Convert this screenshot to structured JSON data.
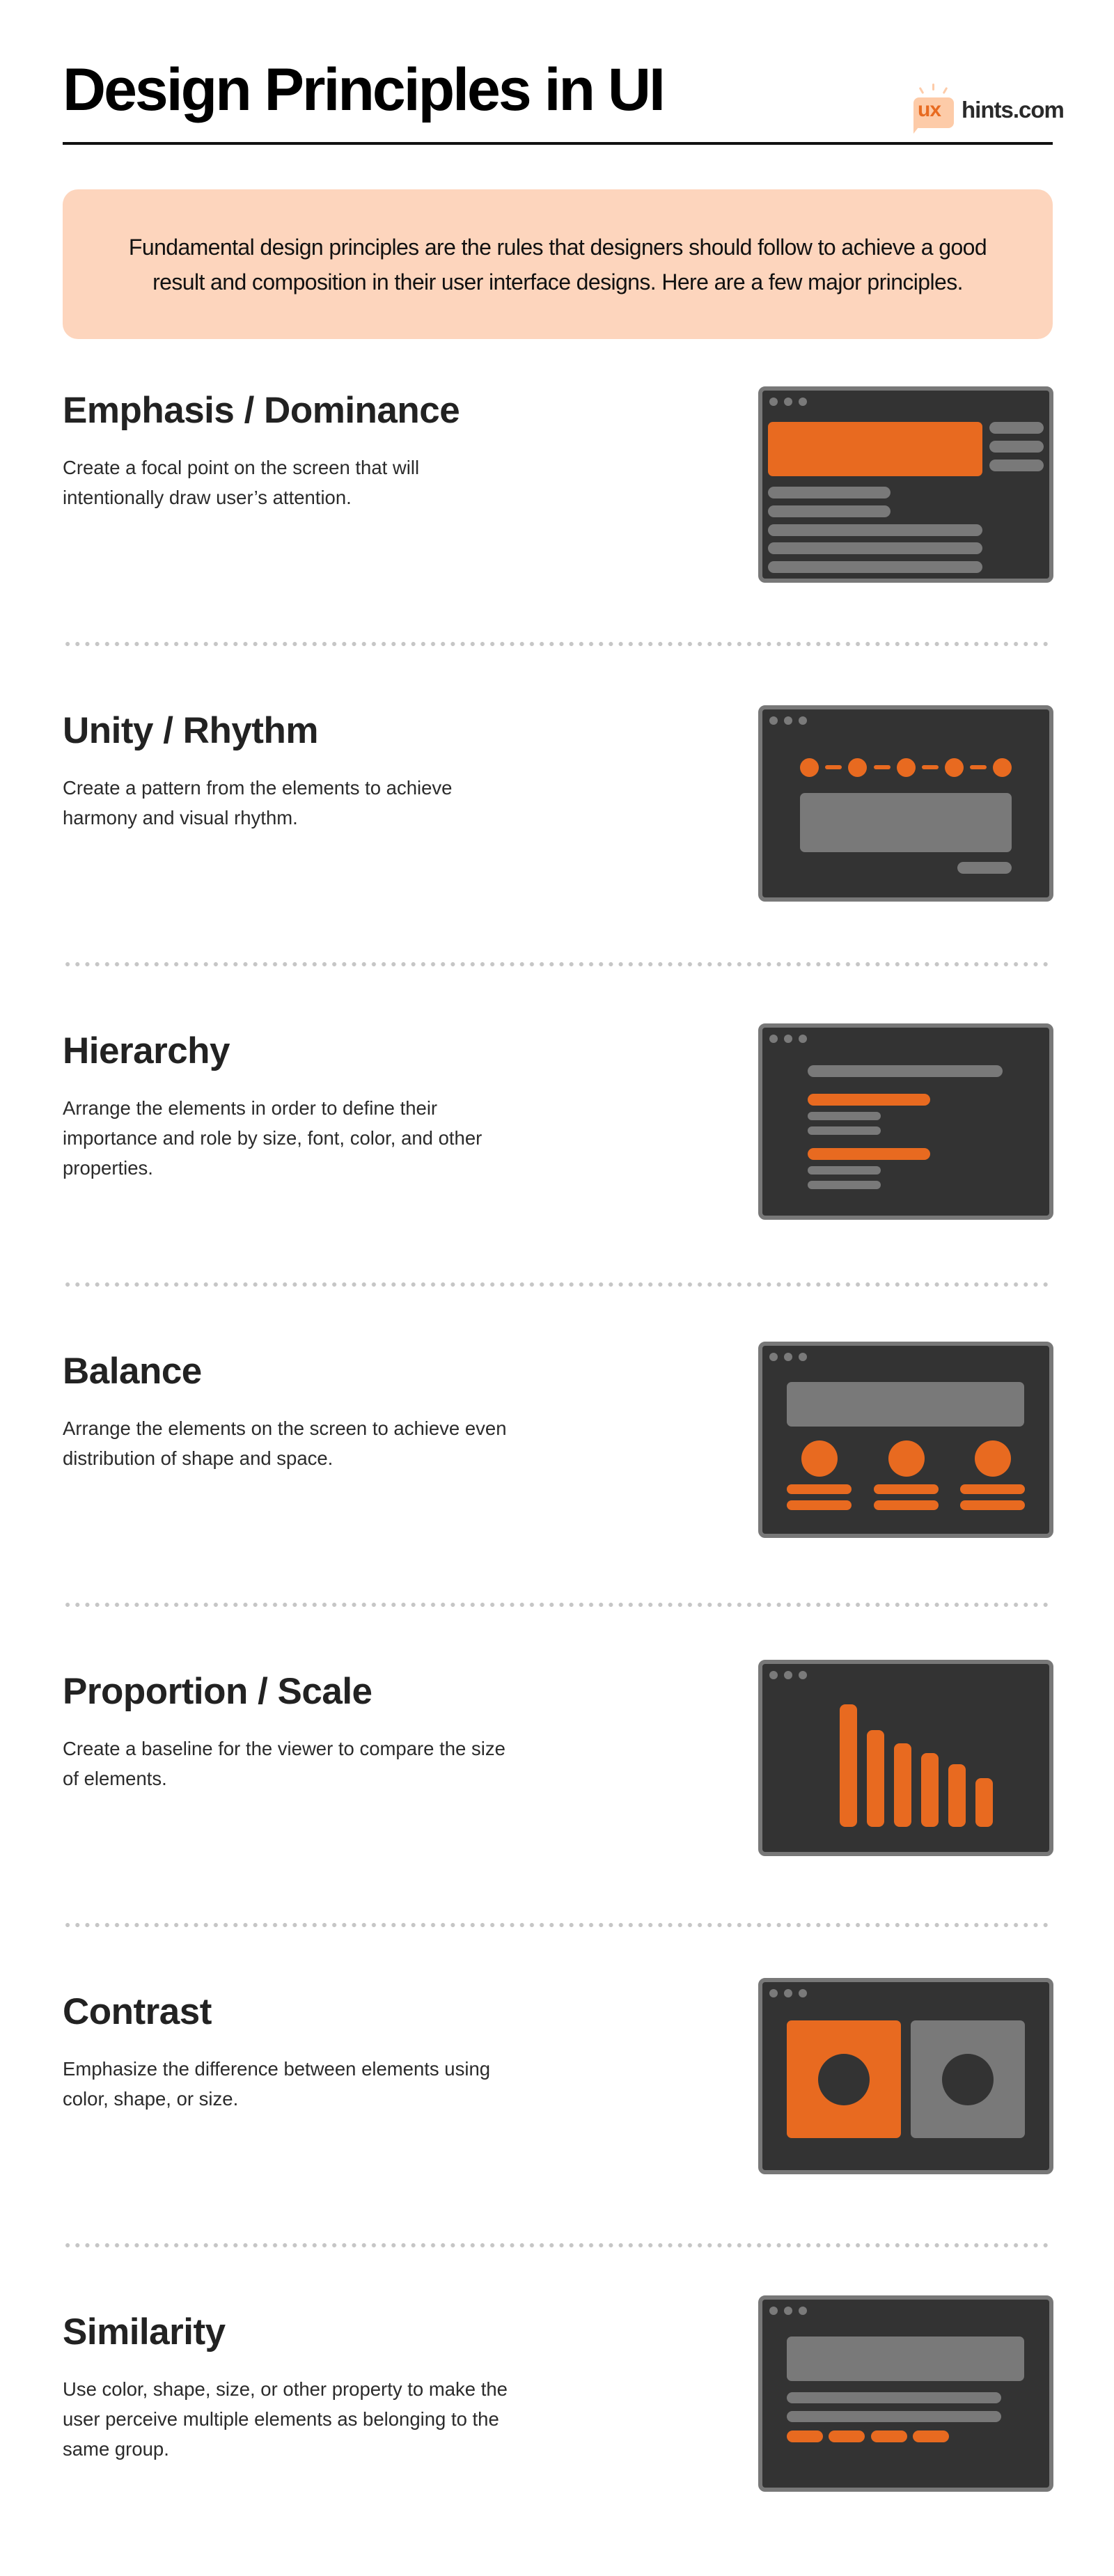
{
  "header": {
    "title": "Design Principles in UI",
    "logo": {
      "badge_text": "ux",
      "site_text": "hints.com",
      "icon": "speech-bubble-icon"
    }
  },
  "intro": {
    "text": "Fundamental design principles are the rules that designers should follow to achieve a good result and composition in their user interface designs. Here are a few major principles."
  },
  "colors": {
    "accent": "#E86A20",
    "intro_bg": "#FDD5BD",
    "window_bg": "#333333",
    "window_border": "#787878",
    "placeholder_gray": "#797979",
    "divider": "#C6C6C6",
    "text": "#222222"
  },
  "sections": [
    {
      "title": "Emphasis / Dominance",
      "description": "Create a focal point on the screen that will intentionally draw user’s attention.",
      "illustration": "emphasis-window-illustration"
    },
    {
      "title": "Unity / Rhythm",
      "description": "Create a pattern from the elements to achieve harmony and visual rhythm.",
      "illustration": "unity-window-illustration"
    },
    {
      "title": "Hierarchy",
      "description": "Arrange the elements in order to define their importance and role by size, font, color, and other properties.",
      "illustration": "hierarchy-window-illustration"
    },
    {
      "title": "Balance",
      "description": "Arrange the elements on the screen to achieve even distribution of shape and space.",
      "illustration": "balance-window-illustration"
    },
    {
      "title": "Proportion / Scale",
      "description": "Create a baseline for the viewer to compare the size of elements.",
      "illustration": "proportion-window-illustration",
      "bar_relative_heights": [
        1.0,
        0.79,
        0.68,
        0.6,
        0.51,
        0.4
      ]
    },
    {
      "title": "Contrast",
      "description": "Emphasize the difference between elements using color, shape, or size.",
      "illustration": "contrast-window-illustration"
    },
    {
      "title": "Similarity",
      "description": "Use color, shape, size, or other property to make the user perceive multiple elements as belonging to the same group.",
      "illustration": "similarity-window-illustration"
    }
  ]
}
